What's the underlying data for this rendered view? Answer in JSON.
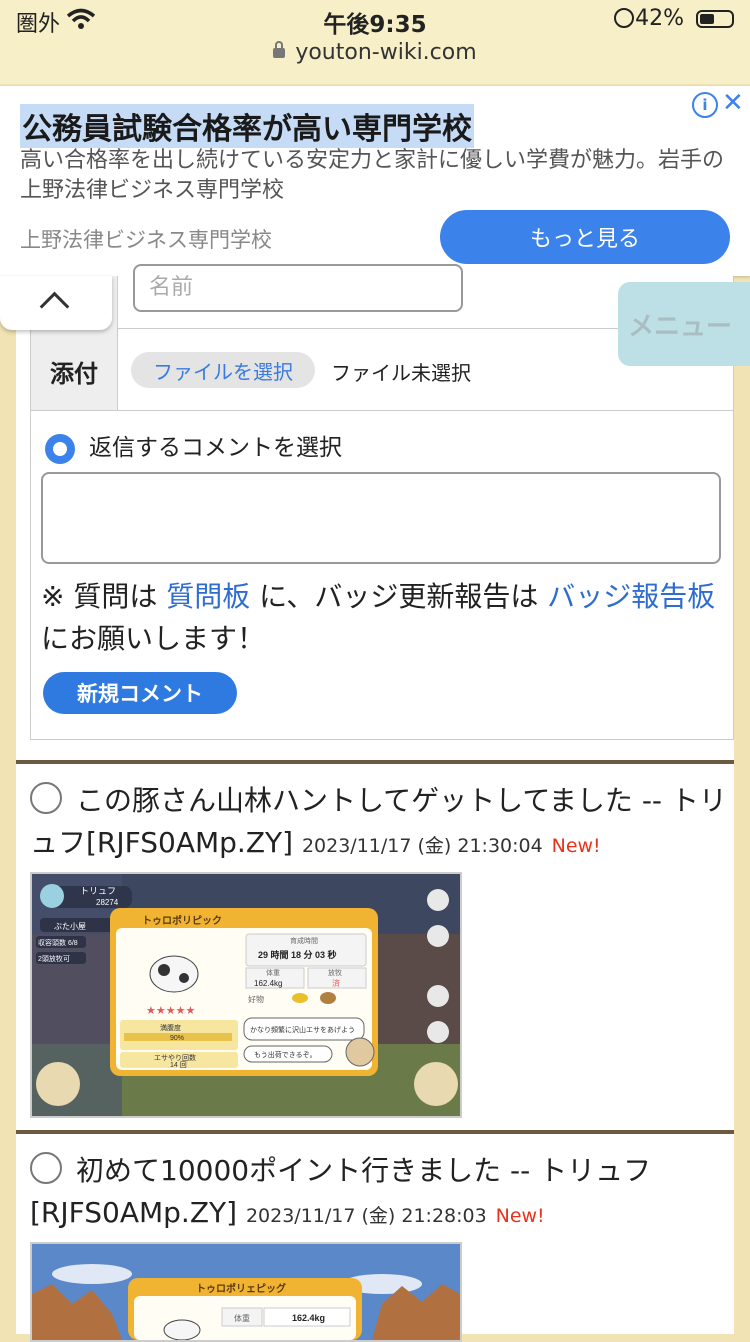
{
  "status_bar": {
    "carrier": "圏外",
    "time": "午後9:35",
    "battery": "42%"
  },
  "url": "youton-wiki.com",
  "ad": {
    "title": "公務員試験合格率が高い専門学校",
    "description": "高い合格率を出し続けている安定力と家計に優しい学費が魅力。岩手の上野法律ビジネス専門学校",
    "source": "上野法律ビジネス専門学校",
    "button": "もっと見る"
  },
  "menu": {
    "label": "メニュー"
  },
  "form": {
    "name_placeholder": "名前",
    "attach_label": "添付",
    "file_button": "ファイルを選択",
    "file_status": "ファイル未選択",
    "reply_label": "返信するコメントを選択",
    "note_pre": "※ 質問は ",
    "note_link1": "質問板",
    "note_mid": " に、バッジ更新報告は ",
    "note_link2": "バッジ報告板",
    "note_post": " にお願いします！",
    "new_comment_button": "新規コメント"
  },
  "posts": [
    {
      "title": "この豚さん山林ハントしてゲットしてました -- トリュフ[RJFS0AMp.ZY]",
      "meta": "2023/11/17 (金) 21:30:04",
      "badge": "New!",
      "screenshot": {
        "player": "トリュフ",
        "points": "28274",
        "pig_name": "トゥロポリピック",
        "grow_label": "育成時間",
        "grow_time": "29 時間 18 分 03 秒",
        "weight_label": "体重",
        "weight": "162.4kg",
        "pasture_label": "放牧",
        "pasture": "済",
        "favorite_label": "好物",
        "satisfaction_label": "満腹度",
        "satisfaction": "90%",
        "feed_label": "エサやり回数",
        "feed_count": "14 回",
        "speech1": "かなり頻繁に沢山エサをあげよう",
        "speech2": "もう出荷できるぞ。",
        "hut": "ぶた小屋",
        "count1": "収容頭数 6/8",
        "count2": "2頭放牧可"
      }
    },
    {
      "title": "初めて10000ポイント行きました -- トリュフ[RJFS0AMp.ZY]",
      "meta": "2023/11/17 (金) 21:28:03",
      "badge": "New!",
      "screenshot": {
        "pig_name": "トゥロポリェピッグ",
        "weight_label": "体重",
        "weight": "162.4kg"
      }
    }
  ]
}
